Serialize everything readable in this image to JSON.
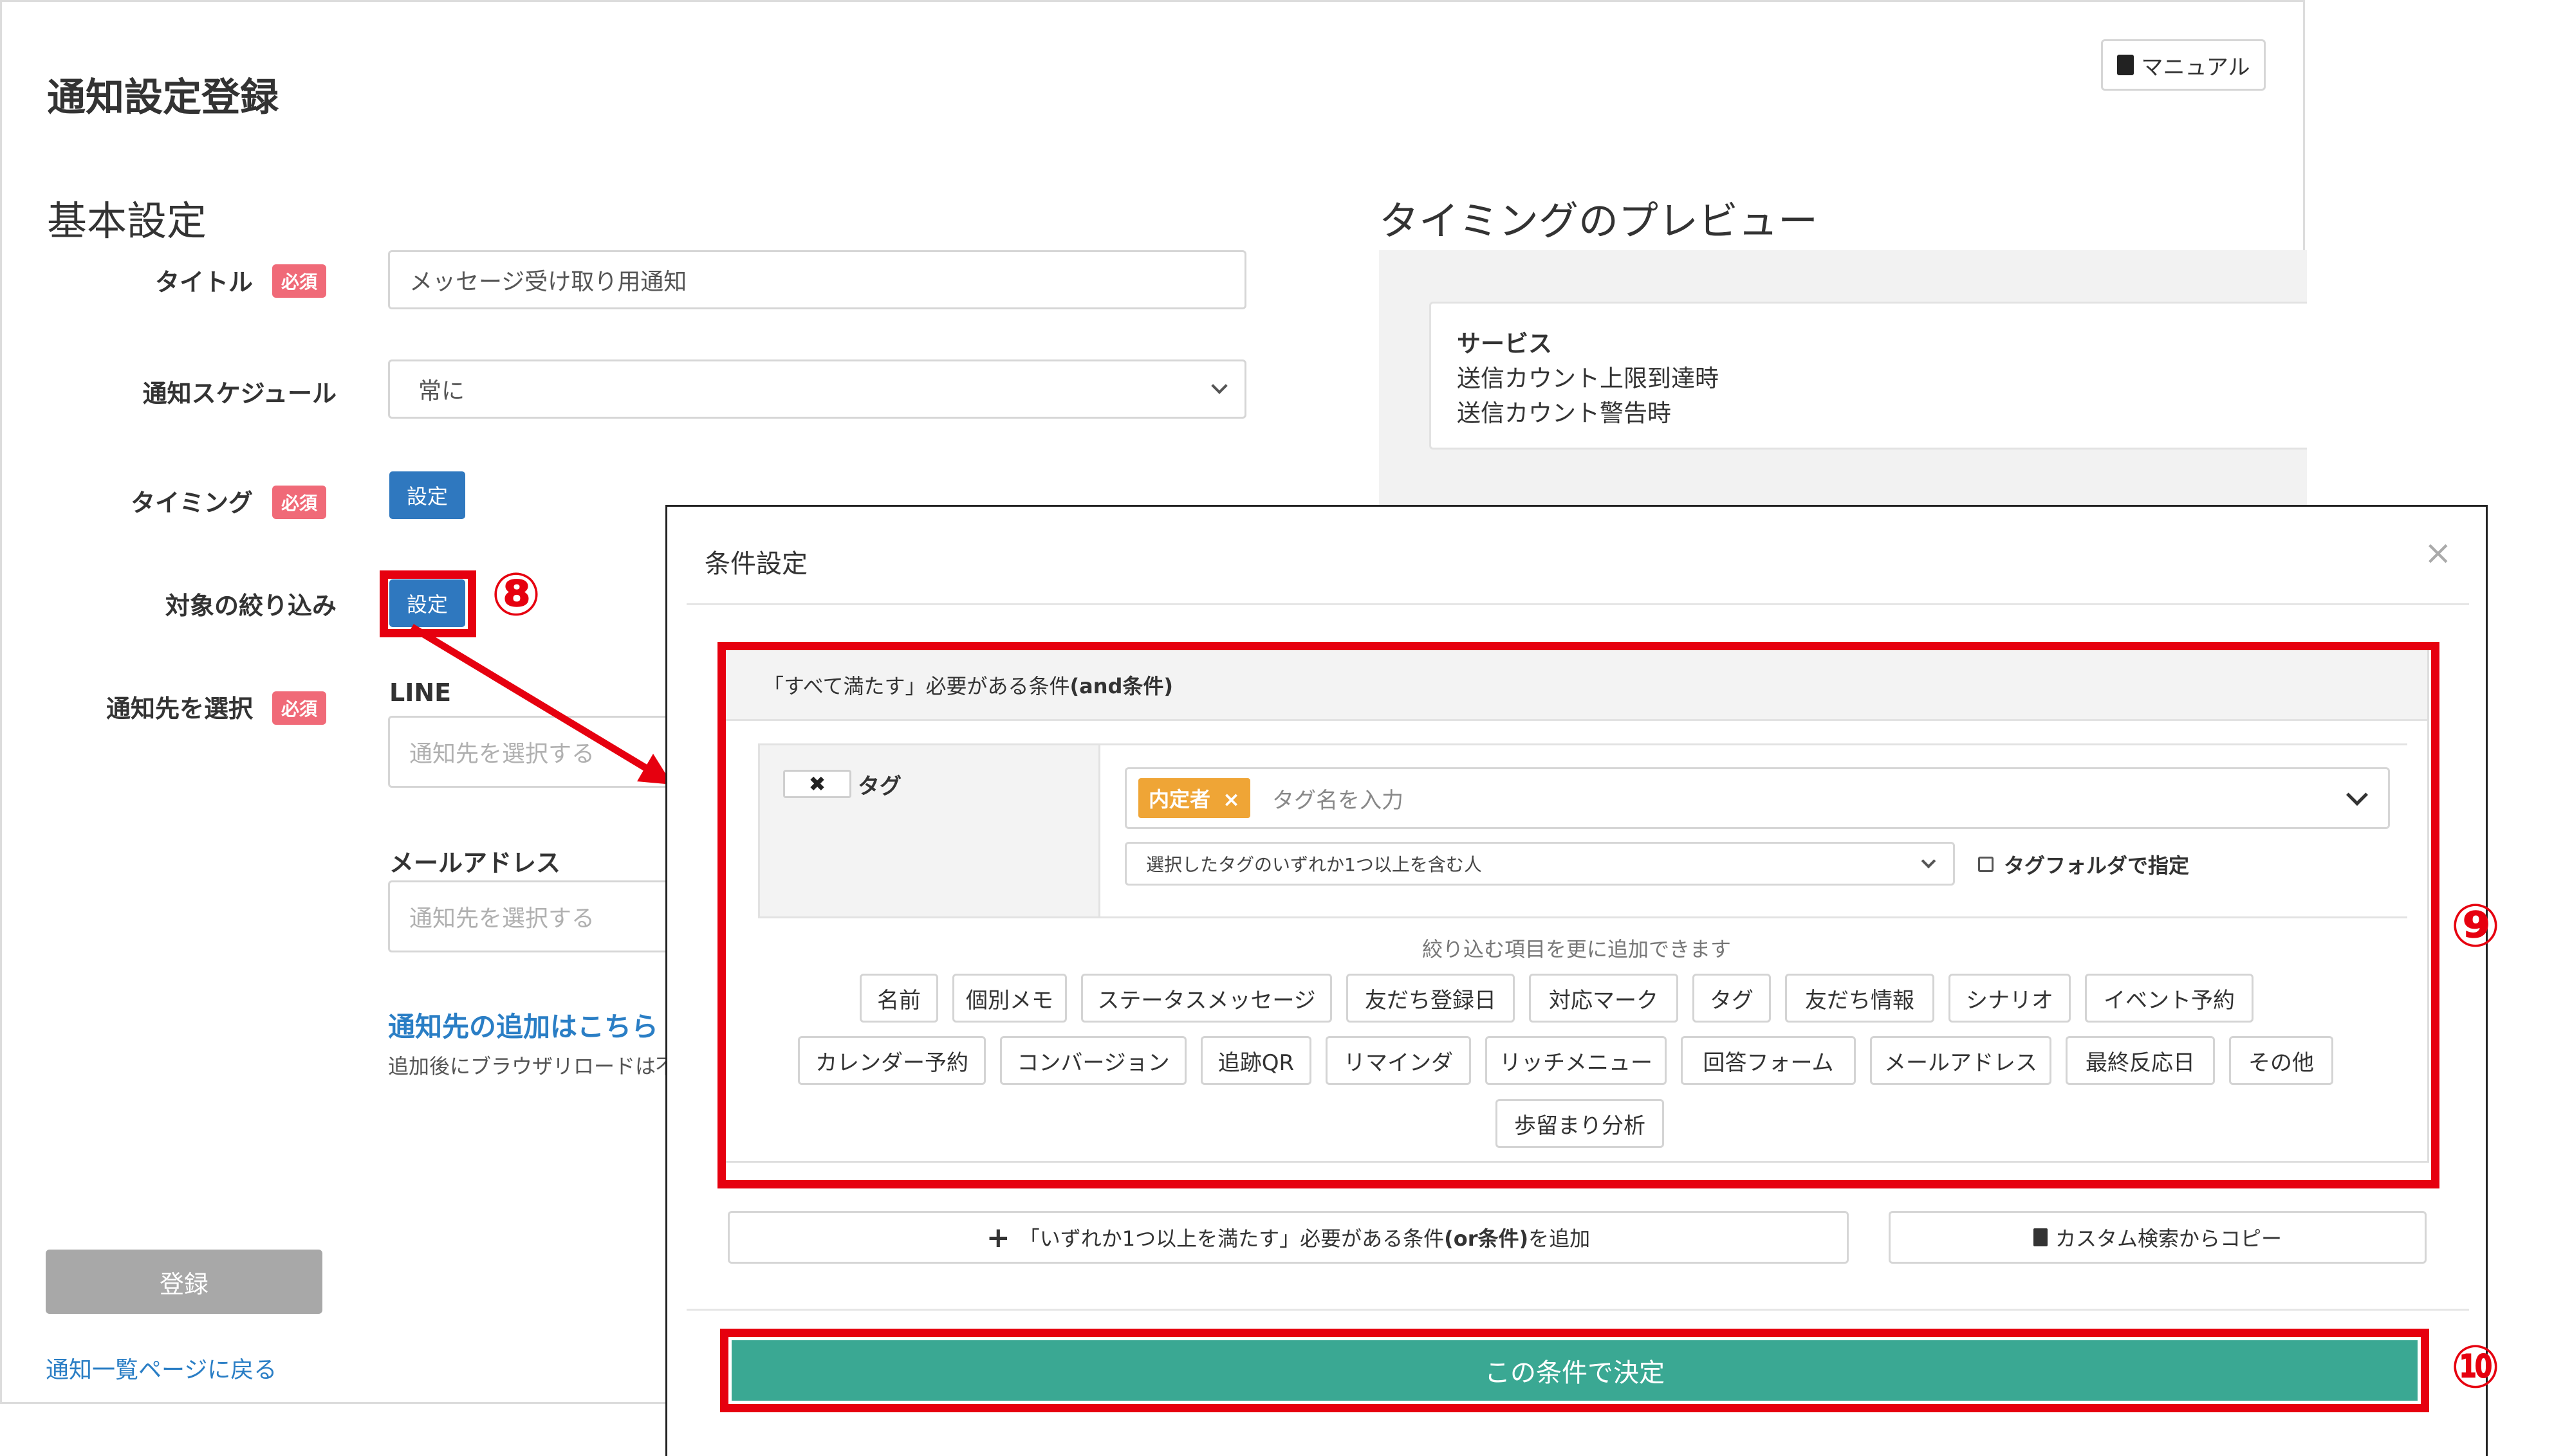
{
  "page": {
    "title": "通知設定登録",
    "manual_button": "マニュアル",
    "section_basic": "基本設定",
    "section_preview": "タイミングのプレビュー",
    "required_badge": "必須",
    "fields": {
      "title_label": "タイトル",
      "title_value": "メッセージ受け取り用通知",
      "schedule_label": "通知スケジュール",
      "schedule_value": "常に",
      "timing_label": "タイミング",
      "timing_button": "設定",
      "filter_label": "対象の絞り込み",
      "filter_button": "設定",
      "destination_label": "通知先を選択",
      "line_label": "LINE",
      "line_placeholder": "通知先を選択する",
      "email_label": "メールアドレス",
      "email_placeholder": "通知先を選択する",
      "add_destination_link": "通知先の追加はこちら",
      "add_destination_note": "追加後にブラウザリロードは不"
    },
    "preview": {
      "heading": "サービス",
      "lines": [
        "送信カウント上限到達時",
        "送信カウント警告時"
      ]
    },
    "register_button": "登録",
    "back_link": "通知一覧ページに戻る"
  },
  "modal": {
    "title": "条件設定",
    "close_symbol": "×",
    "and_section_header_pre": "「すべて満たす」必要がある条件 ",
    "and_section_header_bold": "(and条件)",
    "condition_row": {
      "remove_symbol": "✖",
      "name": "タグ",
      "selected_tag": "内定者",
      "selected_tag_remove": "×",
      "tag_placeholder": "タグ名を入力",
      "match_mode": "選択したタグのいずれか1つ以上を含む人",
      "folder_checkbox_label": "タグフォルダで指定"
    },
    "add_hint": "絞り込む項目を更に追加できます",
    "filter_items_row1": [
      "名前",
      "個別メモ",
      "ステータスメッセージ",
      "友だち登録日",
      "対応マーク",
      "タグ",
      "友だち情報",
      "シナリオ",
      "イベント予約"
    ],
    "filter_items_row2": [
      "カレンダー予約",
      "コンバージョン",
      "追跡QR",
      "リマインダ",
      "リッチメニュー",
      "回答フォーム",
      "メールアドレス",
      "最終反応日",
      "その他"
    ],
    "filter_items_row3": [
      "歩留まり分析"
    ],
    "or_button_pre": "「いずれか1つ以上を満たす」必要がある条件",
    "or_button_bold": "(or条件)",
    "or_button_post": "を追加",
    "copy_button": "カスタム検索からコピー",
    "submit_button": "この条件で決定"
  },
  "annotations": {
    "step8": "⑧",
    "step9": "⑨",
    "step10": "⑩"
  },
  "colors": {
    "primary_blue": "#2f78bf",
    "required_red": "#f06a78",
    "annotation_red": "#e6000f",
    "tag_orange": "#efa536",
    "submit_green": "#3aa893",
    "link_blue": "#2a7ec5"
  }
}
